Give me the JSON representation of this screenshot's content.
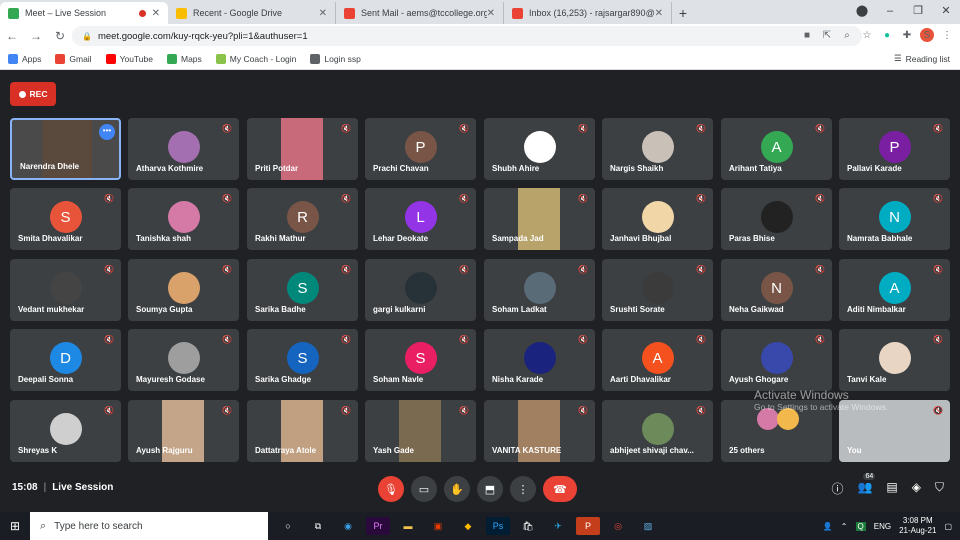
{
  "browser": {
    "tabs": [
      {
        "title": "Meet – Live Session",
        "fav": "#34a853",
        "recording": true
      },
      {
        "title": "Recent - Google Drive",
        "fav": "#fbbc04",
        "recording": false
      },
      {
        "title": "Sent Mail - aems@tccollege.org",
        "fav": "#ea4335",
        "recording": false
      },
      {
        "title": "Inbox (16,253) - rajsargar890@g",
        "fav": "#ea4335",
        "recording": false
      }
    ],
    "url": "meet.google.com/kuy-rqck-yeu?pli=1&authuser=1",
    "profile_letter": "S",
    "bookmarks": [
      {
        "label": "Apps",
        "color": "#4285f4"
      },
      {
        "label": "Gmail",
        "color": "#ea4335"
      },
      {
        "label": "YouTube",
        "color": "#ff0000"
      },
      {
        "label": "Maps",
        "color": "#34a853"
      },
      {
        "label": "My Coach - Login",
        "color": "#8bc34a"
      },
      {
        "label": "Login ssp",
        "color": "#5f6368"
      }
    ],
    "reading_list": "Reading list"
  },
  "meet": {
    "rec_label": "REC",
    "host": "Narendra Dhele",
    "participants": [
      {
        "name": "Atharva Kothmire",
        "kind": "avatar",
        "color": "#a46fb0"
      },
      {
        "name": "Priti Potdar",
        "kind": "photo",
        "color": "#c86a7a"
      },
      {
        "name": "Prachi Chavan",
        "kind": "letter",
        "letter": "P",
        "color": "#795548"
      },
      {
        "name": "Shubh Ahire",
        "kind": "avatar",
        "color": "#ffffff"
      },
      {
        "name": "Nargis Shaikh",
        "kind": "avatar",
        "color": "#c9c0b8"
      },
      {
        "name": "Arihant Tatiya",
        "kind": "letter",
        "letter": "A",
        "color": "#34a853"
      },
      {
        "name": "Pallavi Karade",
        "kind": "letter",
        "letter": "P",
        "color": "#7b1fa2"
      },
      {
        "name": "Smita Dhavalikar",
        "kind": "letter",
        "letter": "S",
        "color": "#e8543a"
      },
      {
        "name": "Tanishka shah",
        "kind": "avatar",
        "color": "#d57aa7"
      },
      {
        "name": "Rakhi Mathur",
        "kind": "letter",
        "letter": "R",
        "color": "#795548"
      },
      {
        "name": "Lehar Deokate",
        "kind": "letter",
        "letter": "L",
        "color": "#9334e6"
      },
      {
        "name": "Sampada Jad",
        "kind": "photo",
        "color": "#b8a36b"
      },
      {
        "name": "Janhavi Bhujbal",
        "kind": "avatar",
        "color": "#f1d6a8"
      },
      {
        "name": "Paras Bhise",
        "kind": "avatar",
        "color": "#222222"
      },
      {
        "name": "Namrata Babhale",
        "kind": "letter",
        "letter": "N",
        "color": "#00acc1"
      },
      {
        "name": "Vedant mukhekar",
        "kind": "avatar",
        "color": "#444444"
      },
      {
        "name": "Soumya Gupta",
        "kind": "avatar",
        "color": "#d9a26a"
      },
      {
        "name": "Sarika Badhe",
        "kind": "letter",
        "letter": "S",
        "color": "#00897b"
      },
      {
        "name": "gargi kulkarni",
        "kind": "avatar",
        "color": "#263238"
      },
      {
        "name": "Soham Ladkat",
        "kind": "avatar",
        "color": "#5a6b78"
      },
      {
        "name": "Srushti Sorate",
        "kind": "avatar",
        "color": "#3b3b3b"
      },
      {
        "name": "Neha Gaikwad",
        "kind": "letter",
        "letter": "N",
        "color": "#795548"
      },
      {
        "name": "Aditi Nimbalkar",
        "kind": "letter",
        "letter": "A",
        "color": "#00acc1"
      },
      {
        "name": "Deepali Sonna",
        "kind": "letter",
        "letter": "D",
        "color": "#1e88e5"
      },
      {
        "name": "Mayuresh Godase",
        "kind": "avatar",
        "color": "#9e9e9e"
      },
      {
        "name": "Sarika Ghadge",
        "kind": "letter",
        "letter": "S",
        "color": "#1565c0"
      },
      {
        "name": "Soham Navle",
        "kind": "letter",
        "letter": "S",
        "color": "#e91e63"
      },
      {
        "name": "Nisha Karade",
        "kind": "avatar",
        "color": "#1a237e"
      },
      {
        "name": "Aarti Dhavalikar",
        "kind": "letter",
        "letter": "A",
        "color": "#f4511e"
      },
      {
        "name": "Ayush Ghogare",
        "kind": "avatar",
        "color": "#3949ab"
      },
      {
        "name": "Tanvi Kale",
        "kind": "avatar",
        "color": "#e8d5c4"
      },
      {
        "name": "Shreyas K",
        "kind": "avatar",
        "color": "#cfcfcf"
      },
      {
        "name": "Ayush Rajguru",
        "kind": "photo",
        "color": "#c4a58a"
      },
      {
        "name": "Dattatraya Atole",
        "kind": "photo",
        "color": "#c0a080"
      },
      {
        "name": "Yash Gade",
        "kind": "photo",
        "color": "#7a6a50"
      },
      {
        "name": "VANITA KASTURE",
        "kind": "photo",
        "color": "#a08060"
      },
      {
        "name": "abhijeet shivaji chav...",
        "kind": "avatar",
        "color": "#6d8b5a"
      },
      {
        "name": "25 others",
        "kind": "others",
        "color": "#d57aa7"
      },
      {
        "name": "You",
        "kind": "photo",
        "color": "#b9bcbf"
      }
    ],
    "clock": "15:08",
    "meeting_name": "Live Session",
    "badge": "64"
  },
  "watermark": {
    "line1": "Activate Windows",
    "line2": "Go to Settings to activate Windows."
  },
  "taskbar": {
    "search_placeholder": "Type here to search",
    "lang": "ENG",
    "time": "3:08 PM",
    "date": "21-Aug-21"
  }
}
